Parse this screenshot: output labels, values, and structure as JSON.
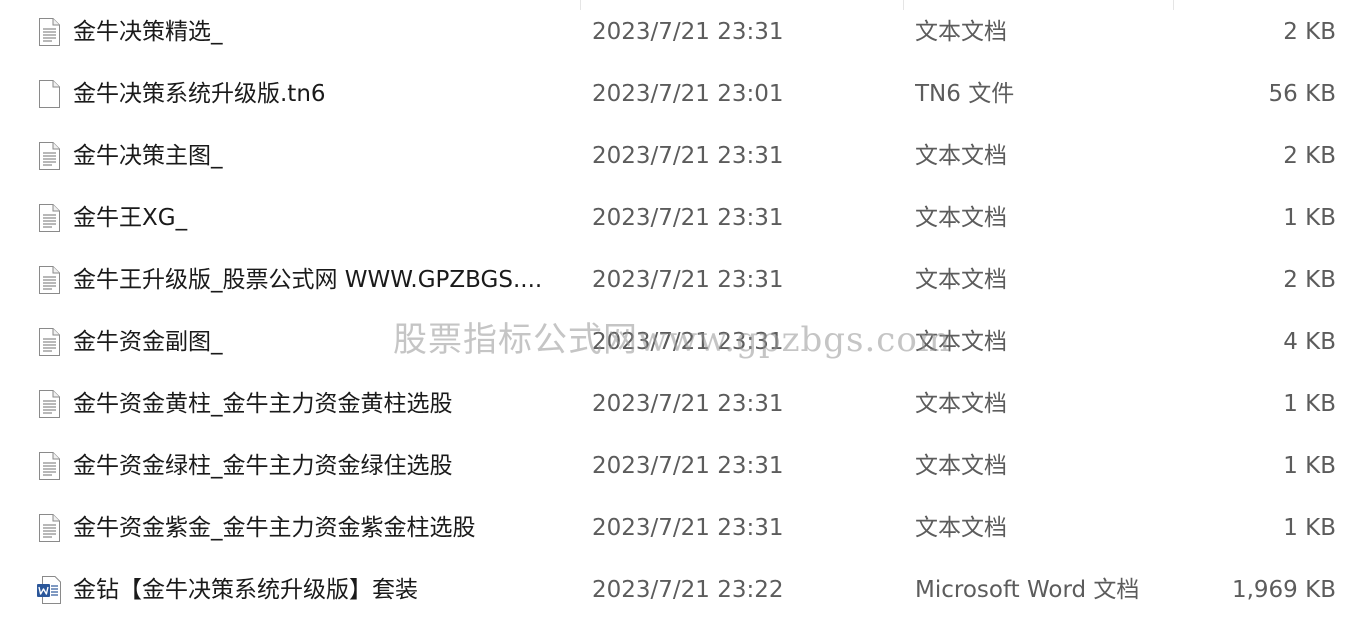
{
  "files": [
    {
      "name": "金牛决策精选_",
      "date": "2023/7/21 23:31",
      "type": "文本文档",
      "size": "2 KB",
      "icon": "text-document-icon"
    },
    {
      "name": "金牛决策系统升级版.tn6",
      "date": "2023/7/21 23:01",
      "type": "TN6 文件",
      "size": "56 KB",
      "icon": "blank-file-icon"
    },
    {
      "name": "金牛决策主图_",
      "date": "2023/7/21 23:31",
      "type": "文本文档",
      "size": "2 KB",
      "icon": "text-document-icon"
    },
    {
      "name": "金牛王XG_",
      "date": "2023/7/21 23:31",
      "type": "文本文档",
      "size": "1 KB",
      "icon": "text-document-icon"
    },
    {
      "name": "金牛王升级版_股票公式网 WWW.GPZBGS....",
      "date": "2023/7/21 23:31",
      "type": "文本文档",
      "size": "2 KB",
      "icon": "text-document-icon"
    },
    {
      "name": "金牛资金副图_",
      "date": "2023/7/21 23:31",
      "type": "文本文档",
      "size": "4 KB",
      "icon": "text-document-icon"
    },
    {
      "name": "金牛资金黄柱_金牛主力资金黄柱选股",
      "date": "2023/7/21 23:31",
      "type": "文本文档",
      "size": "1 KB",
      "icon": "text-document-icon"
    },
    {
      "name": "金牛资金绿柱_金牛主力资金绿住选股",
      "date": "2023/7/21 23:31",
      "type": "文本文档",
      "size": "1 KB",
      "icon": "text-document-icon"
    },
    {
      "name": "金牛资金紫金_金牛主力资金紫金柱选股",
      "date": "2023/7/21 23:31",
      "type": "文本文档",
      "size": "1 KB",
      "icon": "text-document-icon"
    },
    {
      "name": "金钻【金牛决策系统升级版】套装",
      "date": "2023/7/21 23:22",
      "type": "Microsoft Word 文档",
      "size": "1,969 KB",
      "icon": "word-document-icon"
    }
  ],
  "watermark": "股票指标公式网www.gpzbgs.com",
  "colors": {
    "name_text": "#1a1a1a",
    "detail_text": "#5c5c5c",
    "word_blue": "#2b579a",
    "watermark": "#969696"
  }
}
